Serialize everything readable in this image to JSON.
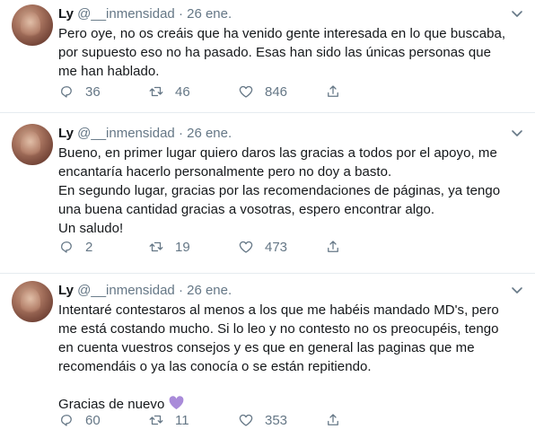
{
  "tweets": [
    {
      "name": "Ly",
      "handle": "@__inmensidad",
      "dot": "·",
      "date": "26 ene.",
      "text": "Pero oye, no os creáis que ha venido gente interesada en lo que buscaba,\npor supuesto eso no ha pasado. Esas han sido las únicas personas que\nme han hablado.",
      "replies": "36",
      "retweets": "46",
      "likes": "846"
    },
    {
      "name": "Ly",
      "handle": "@__inmensidad",
      "dot": "·",
      "date": "26 ene.",
      "text": "Bueno, en primer lugar quiero daros las gracias a todos por el apoyo, me\nencantaría hacerlo personalmente pero no doy a basto.\nEn segundo lugar, gracias por las recomendaciones de páginas, ya tengo\nuna buena cantidad gracias a vosotras, espero encontrar algo.\nUn saludo!",
      "replies": "2",
      "retweets": "19",
      "likes": "473"
    },
    {
      "name": "Ly",
      "handle": "@__inmensidad",
      "dot": "·",
      "date": "26 ene.",
      "text": "Intentaré contestaros al menos a los que me habéis mandado MD's, pero\nme está costando mucho. Si lo leo y no contesto no os preocupéis, tengo\nen cuenta vuestros consejos y es que en general las paginas que me\nrecomendáis o ya las conocía o se están repitiendo.\n\nGracias de nuevo",
      "emoji": "purple-heart",
      "replies": "60",
      "retweets": "11",
      "likes": "353"
    }
  ],
  "icons": {
    "reply": "reply-icon",
    "retweet": "retweet-icon",
    "like": "like-icon",
    "share": "share-icon",
    "menu": "chevron-down-icon"
  },
  "colors": {
    "text": "#14171a",
    "muted": "#657786",
    "divider": "#e6ecf0",
    "emoji": "#a98bd9"
  }
}
